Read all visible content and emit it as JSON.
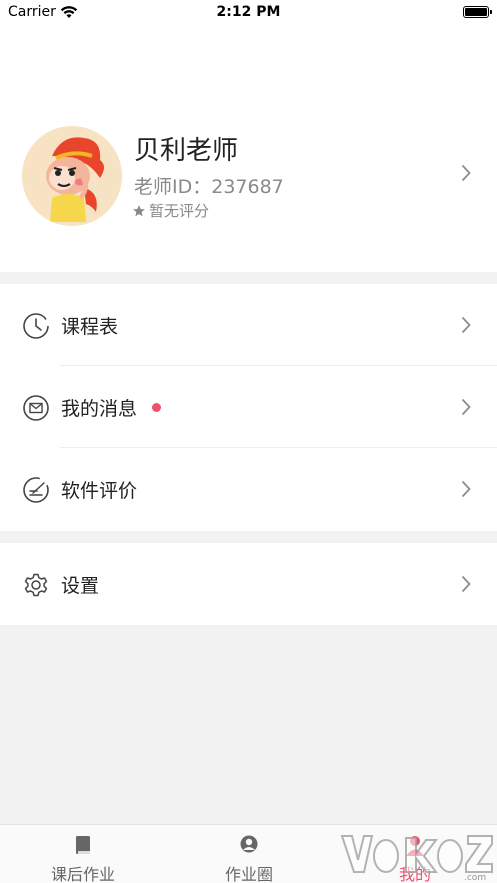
{
  "status_bar": {
    "carrier": "Carrier",
    "time": "2:12 PM"
  },
  "profile": {
    "name": "贝利老师",
    "teacher_id": "老师ID：237687",
    "rating": "暂无评分"
  },
  "menu": {
    "items": [
      {
        "label": "课程表",
        "icon": "clock-icon"
      },
      {
        "label": "我的消息",
        "icon": "envelope-icon",
        "has_unread": true
      },
      {
        "label": "软件评价",
        "icon": "pencil-edit-icon"
      }
    ],
    "settings": {
      "label": "设置",
      "icon": "gear-icon"
    }
  },
  "tabbar": {
    "tabs": [
      {
        "label": "课后作业",
        "icon": "book-icon",
        "active": false
      },
      {
        "label": "作业圈",
        "icon": "people-icon",
        "active": false
      },
      {
        "label": "我的",
        "icon": "person-icon",
        "active": true
      }
    ]
  },
  "colors": {
    "accent": "#f0506e",
    "background": "#f2f2f2"
  }
}
